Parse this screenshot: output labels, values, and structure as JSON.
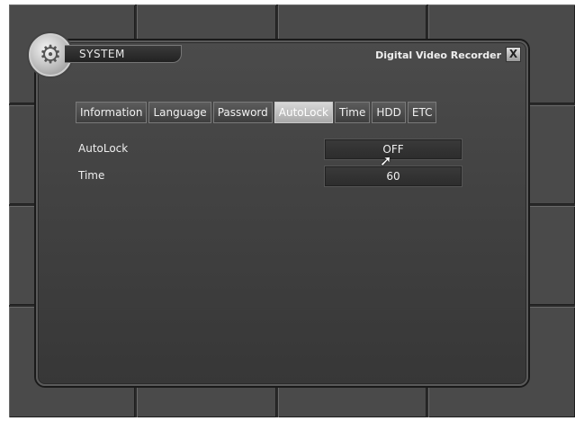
{
  "window": {
    "section": "SYSTEM",
    "app_title": "Digital Video Recorder",
    "close_glyph": "X"
  },
  "tabs": [
    {
      "label": "Information",
      "active": false
    },
    {
      "label": "Language",
      "active": false
    },
    {
      "label": "Password",
      "active": false
    },
    {
      "label": "AutoLock",
      "active": true
    },
    {
      "label": "Time",
      "active": false
    },
    {
      "label": "HDD",
      "active": false
    },
    {
      "label": "ETC",
      "active": false
    }
  ],
  "settings": [
    {
      "label": "AutoLock",
      "value": "OFF"
    },
    {
      "label": "Time",
      "value": "60"
    }
  ],
  "icons": {
    "settings_icon": "gear-icon",
    "close_icon": "close-icon",
    "pointer_icon": "mouse-cursor-icon"
  }
}
